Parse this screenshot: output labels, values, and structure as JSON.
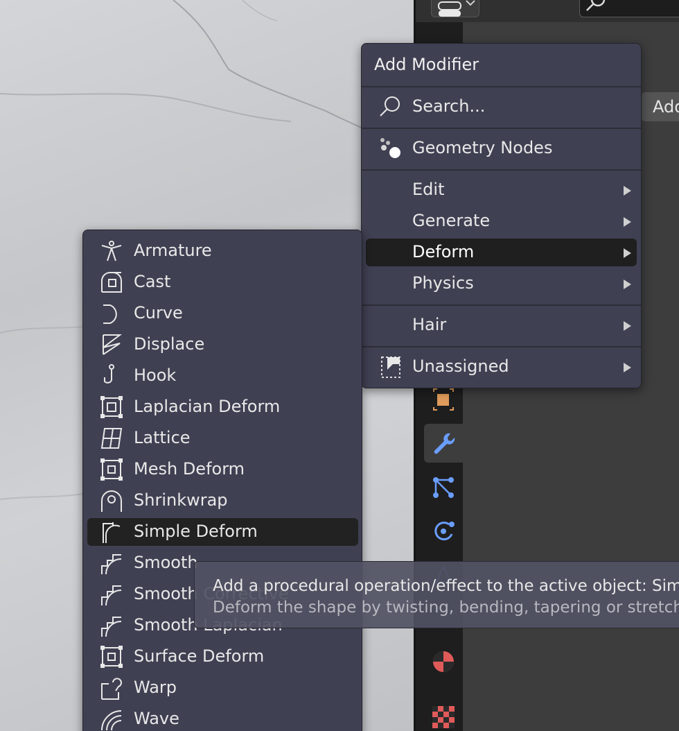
{
  "add_modifier_menu": {
    "title": "Add Modifier",
    "search_label": "Search...",
    "geometry_nodes_label": "Geometry Nodes",
    "categories": [
      {
        "label": "Edit",
        "icon": "none"
      },
      {
        "label": "Generate",
        "icon": "none"
      },
      {
        "label": "Deform",
        "icon": "none",
        "highlighted": true
      },
      {
        "label": "Physics",
        "icon": "none"
      },
      {
        "label": "Hair",
        "icon": "none"
      },
      {
        "label": "Unassigned",
        "icon": "unassigned-icon"
      }
    ]
  },
  "deform_submenu": {
    "items": [
      {
        "label": "Armature",
        "icon": "armature-icon"
      },
      {
        "label": "Cast",
        "icon": "cast-icon"
      },
      {
        "label": "Curve",
        "icon": "curve-icon"
      },
      {
        "label": "Displace",
        "icon": "displace-icon"
      },
      {
        "label": "Hook",
        "icon": "hook-icon"
      },
      {
        "label": "Laplacian Deform",
        "icon": "laplacian-deform-icon"
      },
      {
        "label": "Lattice",
        "icon": "lattice-icon"
      },
      {
        "label": "Mesh Deform",
        "icon": "mesh-deform-icon"
      },
      {
        "label": "Shrinkwrap",
        "icon": "shrinkwrap-icon"
      },
      {
        "label": "Simple Deform",
        "icon": "simple-deform-icon",
        "highlighted": true
      },
      {
        "label": "Smooth",
        "icon": "smooth-icon"
      },
      {
        "label": "Smooth Corrective",
        "icon": "smooth-corrective-icon"
      },
      {
        "label": "Smooth Laplacian",
        "icon": "smooth-laplacian-icon"
      },
      {
        "label": "Surface Deform",
        "icon": "surface-deform-icon"
      },
      {
        "label": "Warp",
        "icon": "warp-icon"
      },
      {
        "label": "Wave",
        "icon": "wave-icon"
      }
    ]
  },
  "tooltip": {
    "line1": "Add a procedural operation/effect to the active object:  Simple Deform",
    "line2": "Deform the shape by twisting, bending, tapering or stretching"
  },
  "properties_editor": {
    "add_modifier_button_partial": "Add"
  },
  "colors": {
    "menu_bg": "#3f4052",
    "highlight_bg": "#1f1f1f",
    "modifier_tab_icon": "#6a9eff",
    "object_tab_icon": "#e09c5c",
    "material_tab_icon": "#e05a5a"
  }
}
